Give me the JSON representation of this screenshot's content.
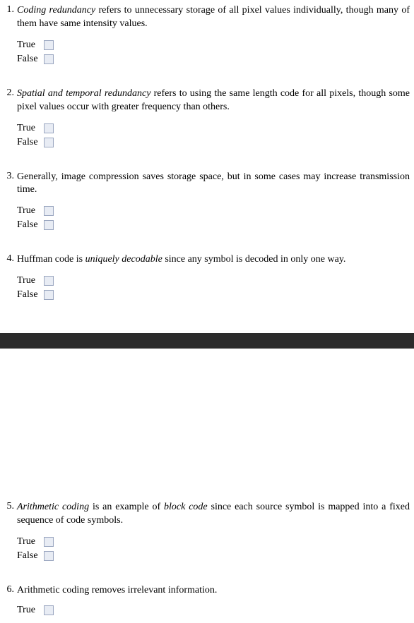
{
  "labels": {
    "true": "True",
    "false": "False"
  },
  "questions": [
    {
      "number": "1.",
      "prefix_emph": "Coding redundancy",
      "rest": " refers to unnecessary storage of all pixel values individually, though many of them have same intensity values."
    },
    {
      "number": "2.",
      "prefix_emph": "Spatial and temporal redundancy",
      "rest": " refers to using the same length code for all pixels, though some pixel values occur with greater frequency than others."
    },
    {
      "number": "3.",
      "prefix_emph": "",
      "rest": "Generally, image compression saves storage space, but in some cases may increase transmission time."
    },
    {
      "number": "4.",
      "prefix_emph": "",
      "rest_pre": "Huffman code is ",
      "mid_emph": "uniquely decodable",
      "rest_post": " since any symbol is decoded in only one way."
    },
    {
      "number": "5.",
      "prefix_emph": "Arithmetic coding",
      "rest_pre2": " is an example of ",
      "mid_emph2": "block code",
      "rest_post2": " since each source symbol is mapped into a fixed sequence of code symbols."
    },
    {
      "number": "6.",
      "prefix_emph": "",
      "rest": "Arithmetic coding removes irrelevant information."
    }
  ]
}
